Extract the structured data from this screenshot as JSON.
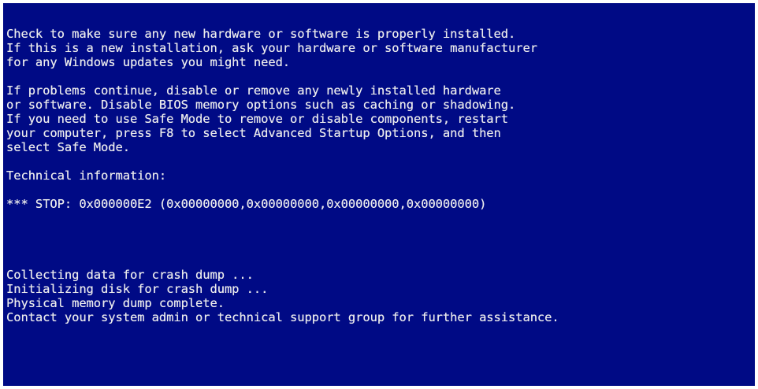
{
  "para1": [
    "Check to make sure any new hardware or software is properly installed.",
    "If this is a new installation, ask your hardware or software manufacturer",
    "for any Windows updates you might need."
  ],
  "para2": [
    "If problems continue, disable or remove any newly installed hardware",
    "or software. Disable BIOS memory options such as caching or shadowing.",
    "If you need to use Safe Mode to remove or disable components, restart",
    "your computer, press F8 to select Advanced Startup Options, and then",
    "select Safe Mode."
  ],
  "technical_header": "Technical information:",
  "stop_line": "*** STOP: 0x000000E2 (0x00000000,0x00000000,0x00000000,0x00000000)",
  "dump": [
    "Collecting data for crash dump ...",
    "Initializing disk for crash dump ...",
    "Physical memory dump complete.",
    "Contact your system admin or technical support group for further assistance."
  ]
}
